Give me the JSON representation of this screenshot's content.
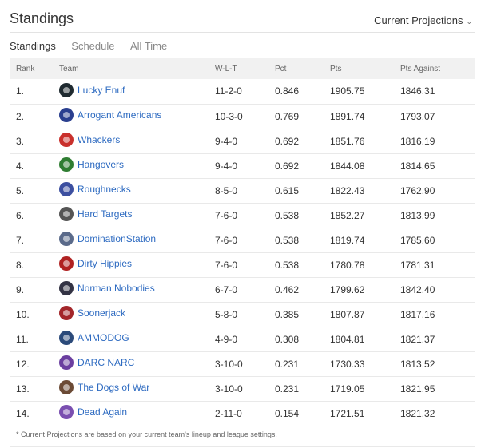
{
  "header": {
    "title": "Standings",
    "projections_label": "Current Projections",
    "caret": "⌄"
  },
  "tabs": [
    {
      "label": "Standings",
      "active": true
    },
    {
      "label": "Schedule",
      "active": false
    },
    {
      "label": "All Time",
      "active": false
    }
  ],
  "columns": {
    "rank": "Rank",
    "team": "Team",
    "wlt": "W-L-T",
    "pct": "Pct",
    "pts": "Pts",
    "pts_against": "Pts Against"
  },
  "rows": [
    {
      "rank": "1.",
      "team": "Lucky Enuf",
      "wlt": "11-2-0",
      "pct": "0.846",
      "pts": "1905.75",
      "pa": "1846.31",
      "logo_color": "#1f2a30",
      "icon": "football-helmet-icon"
    },
    {
      "rank": "2.",
      "team": "Arrogant Americans",
      "wlt": "10-3-0",
      "pct": "0.769",
      "pts": "1891.74",
      "pa": "1793.07",
      "logo_color": "#2a3f8f",
      "icon": "star-badge-icon"
    },
    {
      "rank": "3.",
      "team": "Whackers",
      "wlt": "9-4-0",
      "pct": "0.692",
      "pts": "1851.76",
      "pa": "1816.19",
      "logo_color": "#c9302c",
      "icon": "mushroom-icon"
    },
    {
      "rank": "4.",
      "team": "Hangovers",
      "wlt": "9-4-0",
      "pct": "0.692",
      "pts": "1844.08",
      "pa": "1814.65",
      "logo_color": "#2f7d32",
      "icon": "team-logo-icon"
    },
    {
      "rank": "5.",
      "team": "Roughnecks",
      "wlt": "8-5-0",
      "pct": "0.615",
      "pts": "1822.43",
      "pa": "1762.90",
      "logo_color": "#3c4fa0",
      "icon": "football-helmet-icon"
    },
    {
      "rank": "6.",
      "team": "Hard Targets",
      "wlt": "7-6-0",
      "pct": "0.538",
      "pts": "1852.27",
      "pa": "1813.99",
      "logo_color": "#555555",
      "icon": "skull-icon"
    },
    {
      "rank": "7.",
      "team": "DominationStation",
      "wlt": "7-6-0",
      "pct": "0.538",
      "pts": "1819.74",
      "pa": "1785.60",
      "logo_color": "#5a6a8a",
      "icon": "rocket-icon"
    },
    {
      "rank": "8.",
      "team": "Dirty Hippies",
      "wlt": "7-6-0",
      "pct": "0.538",
      "pts": "1780.78",
      "pa": "1781.31",
      "logo_color": "#b02222",
      "icon": "character-icon"
    },
    {
      "rank": "9.",
      "team": "Norman Nobodies",
      "wlt": "6-7-0",
      "pct": "0.462",
      "pts": "1799.62",
      "pa": "1842.40",
      "logo_color": "#333344",
      "icon": "mask-icon"
    },
    {
      "rank": "10.",
      "team": "Soonerjack",
      "wlt": "5-8-0",
      "pct": "0.385",
      "pts": "1807.87",
      "pa": "1817.16",
      "logo_color": "#a3262a",
      "icon": "football-helmet-icon"
    },
    {
      "rank": "11.",
      "team": "AMMODOG",
      "wlt": "4-9-0",
      "pct": "0.308",
      "pts": "1804.81",
      "pa": "1821.37",
      "logo_color": "#2b4a7a",
      "icon": "dog-icon"
    },
    {
      "rank": "12.",
      "team": "DARC NARC",
      "wlt": "3-10-0",
      "pct": "0.231",
      "pts": "1730.33",
      "pa": "1813.52",
      "logo_color": "#6b3fa0",
      "icon": "football-helmet-icon"
    },
    {
      "rank": "13.",
      "team": "The Dogs of War",
      "wlt": "3-10-0",
      "pct": "0.231",
      "pts": "1719.05",
      "pa": "1821.95",
      "logo_color": "#6b4a35",
      "icon": "dog-icon"
    },
    {
      "rank": "14.",
      "team": "Dead Again",
      "wlt": "2-11-0",
      "pct": "0.154",
      "pts": "1721.51",
      "pa": "1821.32",
      "logo_color": "#7a4fb0",
      "icon": "football-helmet-icon"
    }
  ],
  "footnote": "* Current Projections are based on your current team's lineup and league settings.",
  "colors": {
    "link": "#2e6bc1",
    "header_bg": "#f1f1f1"
  }
}
